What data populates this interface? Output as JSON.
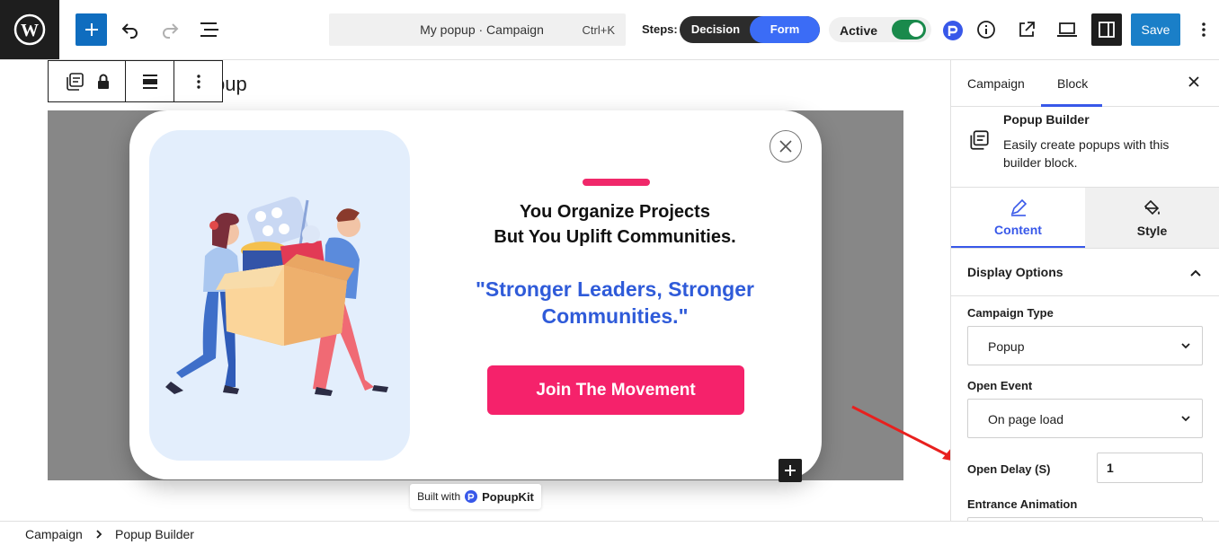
{
  "topbar": {
    "command_title": "My popup · Campaign",
    "command_shortcut": "Ctrl+K",
    "steps_label": "Steps:",
    "steps": [
      "Decision",
      "Form"
    ],
    "active_label": "Active",
    "save_label": "Save"
  },
  "canvas": {
    "title_fragment": "pup",
    "popup": {
      "headline_line1": "You Organize Projects",
      "headline_line2": "But You Uplift Communities.",
      "quote_line1": "\"Stronger Leaders, Stronger",
      "quote_line2": "Communities.\"",
      "cta": "Join The Movement"
    },
    "built_with": "Built with",
    "built_brand": "PopupKit"
  },
  "breadcrumb": [
    "Campaign",
    "Popup Builder"
  ],
  "sidebar": {
    "tabs": [
      "Campaign",
      "Block"
    ],
    "block_name": "Popup Builder",
    "block_description": "Easily create popups with this builder block.",
    "subtabs": [
      "Content",
      "Style"
    ],
    "section_title": "Display Options",
    "campaign_type_label": "Campaign Type",
    "campaign_type_value": "Popup",
    "open_event_label": "Open Event",
    "open_event_value": "On page load",
    "open_delay_label": "Open Delay (S)",
    "open_delay_value": "1",
    "entrance_label": "Entrance Animation"
  },
  "colors": {
    "primary": "#3858e9",
    "cta": "#f5226b",
    "quote": "#2f5bd9",
    "toggle_on": "#1a8a4c"
  }
}
